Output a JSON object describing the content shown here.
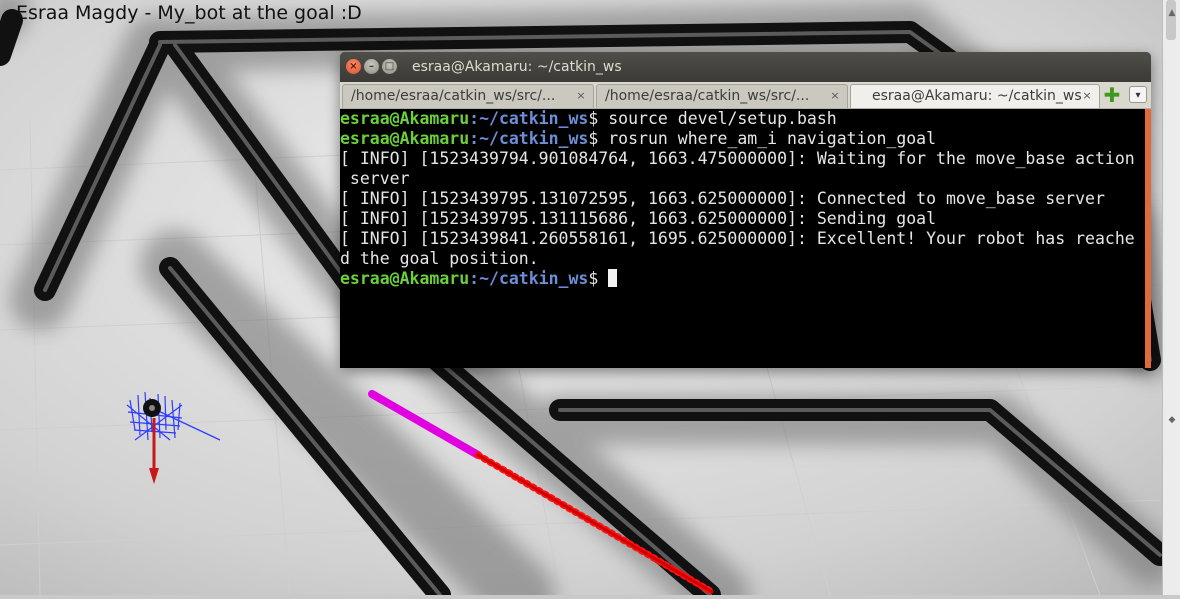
{
  "caption": "Esraa Magdy - My_bot at the goal :D",
  "terminal": {
    "title": "esraa@Akamaru: ~/catkin_ws",
    "tabs": [
      {
        "label": "/home/esraa/catkin_ws/src/..."
      },
      {
        "label": "/home/esraa/catkin_ws/src/..."
      },
      {
        "label": "esraa@Akamaru: ~/catkin_ws"
      }
    ],
    "close_glyph": "×",
    "min_glyph": "–",
    "max_glyph": "□",
    "new_tab_glyph": "✚",
    "menu_glyph": "▾",
    "prompt_user": "esraa@Akamaru",
    "prompt_path": ":~/catkin_ws",
    "prompt_symbol": "$ ",
    "lines": [
      {
        "type": "cmd",
        "text": "source devel/setup.bash"
      },
      {
        "type": "cmd",
        "text": "rosrun where_am_i navigation_goal"
      },
      {
        "type": "out",
        "text": "[ INFO] [1523439794.901084764, 1663.475000000]: Waiting for the move_base action"
      },
      {
        "type": "out",
        "text": " server"
      },
      {
        "type": "out",
        "text": "[ INFO] [1523439795.131072595, 1663.625000000]: Connected to move_base server"
      },
      {
        "type": "out",
        "text": "[ INFO] [1523439795.131115686, 1663.625000000]: Sending goal"
      },
      {
        "type": "out",
        "text": "[ INFO] [1523439841.260558161, 1695.625000000]: Excellent! Your robot has reache"
      },
      {
        "type": "out",
        "text": "d the goal position."
      },
      {
        "type": "cmd",
        "text": ""
      }
    ]
  },
  "colors": {
    "prompt_user": "#6ad03a",
    "prompt_path": "#6d8ed6",
    "path_magenta": "#e000e0",
    "path_red": "#f00000",
    "robot_arrow": "#c81818",
    "laser_blue": "#2d3cff",
    "wall": "#0e0e0e"
  },
  "icons": {
    "close": "close-icon",
    "minimize": "minimize-icon",
    "maximize": "maximize-icon",
    "new_tab": "plus-icon",
    "tab_menu": "chevron-down-icon"
  }
}
